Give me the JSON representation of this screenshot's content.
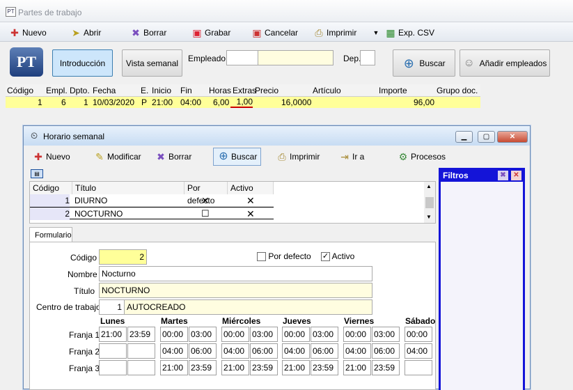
{
  "window": {
    "title": "Partes de trabajo",
    "app_icon": "PT"
  },
  "toolbar": [
    {
      "label": "Nuevo",
      "icon": "new-icon"
    },
    {
      "label": "Abrir",
      "icon": "open-icon"
    },
    {
      "label": "Borrar",
      "icon": "delete-icon"
    },
    {
      "label": "Grabar",
      "icon": "save-icon"
    },
    {
      "label": "Cancelar",
      "icon": "cancel-icon"
    },
    {
      "label": "Imprimir",
      "icon": "print-icon"
    },
    {
      "label": "Exp. CSV",
      "icon": "export-csv-icon"
    }
  ],
  "header": {
    "logo": "PT",
    "btn_introduccion": "Introducción",
    "btn_vista_semanal": "Vista semanal",
    "empleado_label": "Empleado",
    "empleado_value": "",
    "dep_label": "Dep.",
    "dep_value": "",
    "btn_buscar": "Buscar",
    "btn_anadir": "Añadir empleados"
  },
  "parts_grid": {
    "columns": [
      "Código",
      "Empl.",
      "Dpto.",
      "Fecha",
      "E.",
      "Inicio",
      "Fin",
      "Horas",
      "Extras",
      "Precio",
      "Artículo",
      "Importe",
      "Grupo doc."
    ],
    "row": {
      "codigo": "1",
      "empl": "6",
      "dpto": "1",
      "fecha": "10/03/2020",
      "e": "P",
      "inicio": "21:00",
      "fin": "04:00",
      "horas": "6,00",
      "extras": "1,00",
      "precio": "16,0000",
      "articulo": "",
      "importe": "96,00",
      "grupo": ""
    }
  },
  "child": {
    "title": "Horario semanal",
    "toolbar": [
      {
        "label": "Nuevo",
        "icon": "new-icon"
      },
      {
        "label": "Modificar",
        "icon": "edit-icon"
      },
      {
        "label": "Borrar",
        "icon": "delete-icon"
      },
      {
        "label": "Buscar",
        "icon": "search-icon"
      },
      {
        "label": "Imprimir",
        "icon": "print-icon"
      },
      {
        "label": "Ir a",
        "icon": "goto-icon"
      },
      {
        "label": "Procesos",
        "icon": "process-icon"
      }
    ],
    "filtros_title": "Filtros",
    "grid": {
      "columns": [
        "Código",
        "Título",
        "Por defecto",
        "Activo"
      ],
      "rows": [
        {
          "codigo": "1",
          "titulo": "DIURNO",
          "defecto": "✕",
          "activo": "✕"
        },
        {
          "codigo": "2",
          "titulo": "NOCTURNO",
          "defecto": "☐",
          "activo": "✕"
        }
      ]
    },
    "form_tab": "Formulario",
    "form": {
      "codigo_label": "Código",
      "codigo": "2",
      "por_defecto_label": "Por defecto",
      "por_defecto": "",
      "activo_label": "Activo",
      "activo": "✓",
      "nombre_label": "Nombre",
      "nombre": "Nocturno",
      "titulo_label": "Título",
      "titulo": "NOCTURNO",
      "centro_label": "Centro de trabajo",
      "centro_code": "1",
      "centro_name": "AUTOCREADO"
    },
    "days": [
      "Lunes",
      "Martes",
      "Miércoles",
      "Jueves",
      "Viernes",
      "Sábado"
    ],
    "franjas": [
      {
        "label": "Franja 1",
        "times": [
          "21:00",
          "23:59",
          "00:00",
          "03:00",
          "00:00",
          "03:00",
          "00:00",
          "03:00",
          "00:00",
          "03:00",
          "00:00",
          ""
        ]
      },
      {
        "label": "Franja 2",
        "times": [
          "",
          "",
          "04:00",
          "06:00",
          "04:00",
          "06:00",
          "04:00",
          "06:00",
          "04:00",
          "06:00",
          "04:00",
          ""
        ]
      },
      {
        "label": "Franja 3",
        "times": [
          "",
          "",
          "21:00",
          "23:59",
          "21:00",
          "23:59",
          "21:00",
          "23:59",
          "21:00",
          "23:59",
          "",
          ""
        ]
      }
    ]
  }
}
